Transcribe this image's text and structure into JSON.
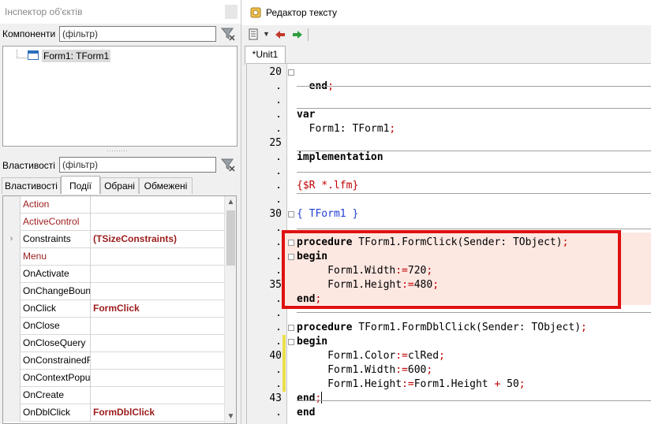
{
  "inspector": {
    "title": "Інспектор об'єктів",
    "components_label": "Компоненти",
    "components_filter_placeholder": "(фільтр)",
    "tree_node": "Form1: TForm1",
    "properties_label": "Властивості",
    "properties_filter_placeholder": "(фільтр)",
    "tabs": [
      "Властивості",
      "Події",
      "Обрані",
      "Обмежені"
    ],
    "active_tab": "Події",
    "rows": [
      {
        "name": "Action",
        "value": "",
        "red": true,
        "expander": ""
      },
      {
        "name": "ActiveControl",
        "value": "",
        "red": true,
        "expander": ""
      },
      {
        "name": "Constraints",
        "value": "(TSizeConstraints)",
        "red": false,
        "expander": "›"
      },
      {
        "name": "Menu",
        "value": "",
        "red": true,
        "expander": ""
      },
      {
        "name": "OnActivate",
        "value": "",
        "red": false,
        "expander": ""
      },
      {
        "name": "OnChangeBoun",
        "value": "",
        "red": false,
        "expander": ""
      },
      {
        "name": "OnClick",
        "value": "FormClick",
        "red": false,
        "expander": ""
      },
      {
        "name": "OnClose",
        "value": "",
        "red": false,
        "expander": ""
      },
      {
        "name": "OnCloseQuery",
        "value": "",
        "red": false,
        "expander": ""
      },
      {
        "name": "OnConstrainedF",
        "value": "",
        "red": false,
        "expander": ""
      },
      {
        "name": "OnContextPopu",
        "value": "",
        "red": false,
        "expander": ""
      },
      {
        "name": "OnCreate",
        "value": "",
        "red": false,
        "expander": ""
      },
      {
        "name": "OnDblClick",
        "value": "FormDblClick",
        "red": false,
        "expander": ""
      }
    ]
  },
  "editor": {
    "title": "Редактор тексту",
    "tab": "*Unit1",
    "gutter": [
      "20",
      ".",
      ".",
      ".",
      ".",
      "25",
      ".",
      ".",
      ".",
      ".",
      "30",
      ".",
      ".",
      ".",
      ".",
      "35",
      ".",
      ".",
      ".",
      ".",
      "40",
      ".",
      ".",
      "43",
      "."
    ],
    "code": [
      [
        {
          "t": "",
          "c": "plain"
        }
      ],
      [
        {
          "t": "  end",
          "c": "kw"
        },
        {
          "t": ";",
          "c": "op"
        }
      ],
      [
        {
          "t": "",
          "c": "plain"
        }
      ],
      [
        {
          "t": "var",
          "c": "kw"
        }
      ],
      [
        {
          "t": "  Form1: TForm1",
          "c": "plain"
        },
        {
          "t": ";",
          "c": "op"
        }
      ],
      [
        {
          "t": "",
          "c": "plain"
        }
      ],
      [
        {
          "t": "implementation",
          "c": "kw"
        }
      ],
      [
        {
          "t": "",
          "c": "plain"
        }
      ],
      [
        {
          "t": "{$R *.lfm}",
          "c": "dir"
        }
      ],
      [
        {
          "t": "",
          "c": "plain"
        }
      ],
      [
        {
          "t": "{ TForm1 }",
          "c": "cmt"
        }
      ],
      [
        {
          "t": "",
          "c": "plain"
        }
      ],
      [
        {
          "t": "procedure",
          "c": "kw"
        },
        {
          "t": " TForm1.FormClick(Sender: TObject)",
          "c": "plain"
        },
        {
          "t": ";",
          "c": "op"
        }
      ],
      [
        {
          "t": "begin",
          "c": "kw"
        }
      ],
      [
        {
          "t": "     Form1.Width",
          "c": "plain"
        },
        {
          "t": ":=",
          "c": "op"
        },
        {
          "t": "720",
          "c": "num"
        },
        {
          "t": ";",
          "c": "op"
        }
      ],
      [
        {
          "t": "     Form1.Height",
          "c": "plain"
        },
        {
          "t": ":=",
          "c": "op"
        },
        {
          "t": "480",
          "c": "num"
        },
        {
          "t": ";",
          "c": "op"
        }
      ],
      [
        {
          "t": "end",
          "c": "kw"
        },
        {
          "t": ";",
          "c": "op"
        }
      ],
      [
        {
          "t": "",
          "c": "plain"
        }
      ],
      [
        {
          "t": "procedure",
          "c": "kw"
        },
        {
          "t": " TForm1.FormDblClick(Sender: TObject)",
          "c": "plain"
        },
        {
          "t": ";",
          "c": "op"
        }
      ],
      [
        {
          "t": "begin",
          "c": "kw"
        }
      ],
      [
        {
          "t": "     Form1.Color",
          "c": "plain"
        },
        {
          "t": ":=",
          "c": "op"
        },
        {
          "t": "clRed",
          "c": "plain"
        },
        {
          "t": ";",
          "c": "op"
        }
      ],
      [
        {
          "t": "     Form1.Width",
          "c": "plain"
        },
        {
          "t": ":=",
          "c": "op"
        },
        {
          "t": "600",
          "c": "num"
        },
        {
          "t": ";",
          "c": "op"
        }
      ],
      [
        {
          "t": "     Form1.Height",
          "c": "plain"
        },
        {
          "t": ":=",
          "c": "op"
        },
        {
          "t": "Form1.Height ",
          "c": "plain"
        },
        {
          "t": "+",
          "c": "op"
        },
        {
          "t": " 50",
          "c": "num"
        },
        {
          "t": ";",
          "c": "op"
        }
      ],
      [
        {
          "t": "end",
          "c": "kw"
        },
        {
          "t": ";",
          "c": "op"
        },
        {
          "t": "|CURSOR|",
          "c": "cursor"
        }
      ],
      [
        {
          "t": "end",
          "c": "kw"
        }
      ]
    ]
  },
  "colors": {
    "highlight_box": "#e01010",
    "highlight_fill": "#fde7e1",
    "event_value": "#9c1c1c"
  }
}
